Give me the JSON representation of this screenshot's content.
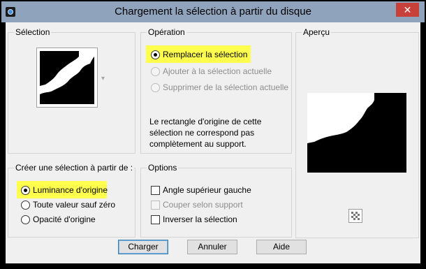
{
  "window": {
    "title": "Chargement la sélection à partir du disque",
    "close_glyph": "✕"
  },
  "selection_group": {
    "label": "Sélection",
    "dropdown_glyph": "▾"
  },
  "operation_group": {
    "label": "Opération",
    "options": [
      {
        "label": "Remplacer la sélection",
        "checked": true,
        "enabled": true,
        "highlighted": true
      },
      {
        "label": "Ajouter à la sélection actuelle",
        "checked": false,
        "enabled": false
      },
      {
        "label": "Supprimer de la sélection actuelle",
        "checked": false,
        "enabled": false
      }
    ],
    "note_lines": [
      "Le rectangle d'origine de cette",
      "sélection ne correspond pas",
      "complètement au support."
    ]
  },
  "preview_group": {
    "label": "Aperçu"
  },
  "create_group": {
    "label": "Créer une sélection à partir de :",
    "options": [
      {
        "label": "Luminance d'origine",
        "checked": true,
        "highlighted": true
      },
      {
        "label": "Toute valeur sauf zéro",
        "checked": false
      },
      {
        "label": "Opacité d'origine",
        "checked": false
      }
    ]
  },
  "options_group": {
    "label": "Options",
    "checkboxes": [
      {
        "label": "Angle supérieur gauche",
        "checked": false,
        "enabled": true
      },
      {
        "label": "Couper selon support",
        "checked": false,
        "enabled": false
      },
      {
        "label": "Inverser la sélection",
        "checked": false,
        "enabled": true
      }
    ]
  },
  "buttons": {
    "ok": "Charger",
    "cancel": "Annuler",
    "help": "Aide"
  },
  "colors": {
    "titlebar": "#8fa3bd",
    "highlight": "#ffff4d",
    "close": "#c7413a",
    "dialog_bg": "#f0f0f0"
  }
}
